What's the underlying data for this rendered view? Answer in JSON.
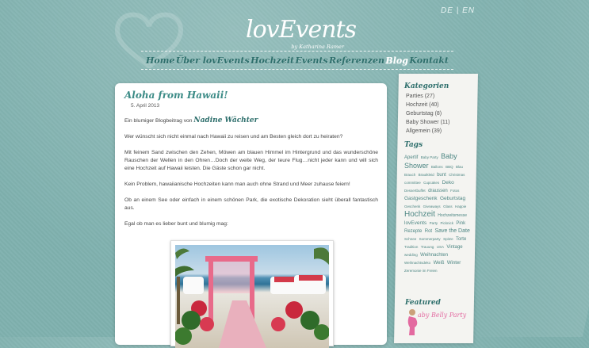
{
  "colors": {
    "teal_dark": "#2e6f6c",
    "teal_title": "#3b8b86",
    "background": "#7fb1ae",
    "pink": "#e36aa0"
  },
  "lang": {
    "de": "DE",
    "sep": "|",
    "en": "EN"
  },
  "logo": {
    "text": "lovEvents",
    "sub": "by Katharina Ramer"
  },
  "nav": {
    "items": [
      {
        "label": "Home"
      },
      {
        "label": "Über lovEvents"
      },
      {
        "label": "Hochzeit"
      },
      {
        "label": "Events"
      },
      {
        "label": "Referenzen"
      },
      {
        "label": "Blog"
      },
      {
        "label": "Kontakt"
      }
    ],
    "active": "Blog"
  },
  "post": {
    "title": "Aloha from Hawaii!",
    "date": "5. April 2013",
    "byline_prefix": "Ein blumiger Blogbeitrag von",
    "author": "Nadine Wächter",
    "paragraphs": [
      "Wer wünscht sich nicht einmal nach Hawaii zu reisen und am Besten gleich dort zu heiraten?",
      "Mit feinem Sand zwischen den Zehen, Möwen am blauen Himmel im Hintergrund und das wunderschöne Rauschen der Wellen in den Ohren…Doch der weite Weg, der teure Flug…nicht jeder kann und will sich eine Hochzeit auf Hawaii leisten. Die Gäste schon gar nicht.",
      "Kein Problem, hawaiianische Hochzeiten kann man auch ohne Strand und Meer zuhause feiern!",
      "Ob an einem See oder einfach in einem schönen Park, die exotische Dekoration sieht überall fantastisch aus.",
      "Egal ob man es lieber bunt und blumig mag:"
    ]
  },
  "sidebar": {
    "categories_title": "Kategorien",
    "categories": [
      {
        "label": "Parties (27)"
      },
      {
        "label": "Hochzeit (40)"
      },
      {
        "label": "Geburtstag (8)"
      },
      {
        "label": "Baby Shower (11)"
      },
      {
        "label": "Allgemein (39)"
      }
    ],
    "tags_title": "Tags",
    "tags": [
      {
        "label": "Apertif",
        "size": 6
      },
      {
        "label": "Baby Party",
        "size": 4.5
      },
      {
        "label": "Baby Shower",
        "size": 9
      },
      {
        "label": "Ballons",
        "size": 4.5
      },
      {
        "label": "BBQ",
        "size": 4.5
      },
      {
        "label": "Blau",
        "size": 4.5
      },
      {
        "label": "Brauch",
        "size": 4.5
      },
      {
        "label": "Brautkleid",
        "size": 4.5
      },
      {
        "label": "bunt",
        "size": 6
      },
      {
        "label": "Christmas",
        "size": 4.5
      },
      {
        "label": "committee",
        "size": 4.5
      },
      {
        "label": "Cupcakes",
        "size": 4.5
      },
      {
        "label": "Deko",
        "size": 6.5
      },
      {
        "label": "Dessertbuffet",
        "size": 4.5
      },
      {
        "label": "draussen",
        "size": 6
      },
      {
        "label": "Fotos",
        "size": 4.5
      },
      {
        "label": "Gastgeschenk",
        "size": 6.5
      },
      {
        "label": "Geburtstag",
        "size": 6.5
      },
      {
        "label": "Geschenk",
        "size": 4.5
      },
      {
        "label": "Giveaways",
        "size": 4.5
      },
      {
        "label": "Glass",
        "size": 4.5
      },
      {
        "label": "Happie",
        "size": 4.5
      },
      {
        "label": "Hochzeit",
        "size": 10
      },
      {
        "label": "Hochzeitsmesse",
        "size": 5
      },
      {
        "label": "lovEvents",
        "size": 6.5
      },
      {
        "label": "Party",
        "size": 4.5
      },
      {
        "label": "Picknick",
        "size": 4.5
      },
      {
        "label": "Pink",
        "size": 6
      },
      {
        "label": "Rezepte",
        "size": 6
      },
      {
        "label": "Rot",
        "size": 6
      },
      {
        "label": "Save the Date",
        "size": 7
      },
      {
        "label": "Schnee",
        "size": 4.5
      },
      {
        "label": "Sommerparty",
        "size": 4.5
      },
      {
        "label": "Spitze",
        "size": 4.5
      },
      {
        "label": "Torte",
        "size": 6
      },
      {
        "label": "Tradition",
        "size": 4.5
      },
      {
        "label": "Trauung",
        "size": 4.5
      },
      {
        "label": "USA",
        "size": 4.5
      },
      {
        "label": "Vintage",
        "size": 6
      },
      {
        "label": "wedding",
        "size": 4.5
      },
      {
        "label": "Weihnachten",
        "size": 6
      },
      {
        "label": "Weihnachtsdeko",
        "size": 4.5
      },
      {
        "label": "Weiß",
        "size": 6
      },
      {
        "label": "Winter",
        "size": 6
      },
      {
        "label": "Zeremonie im Freien",
        "size": 4.5
      }
    ],
    "featured_title": "Featured",
    "featured_text": "aby Belly Party"
  }
}
